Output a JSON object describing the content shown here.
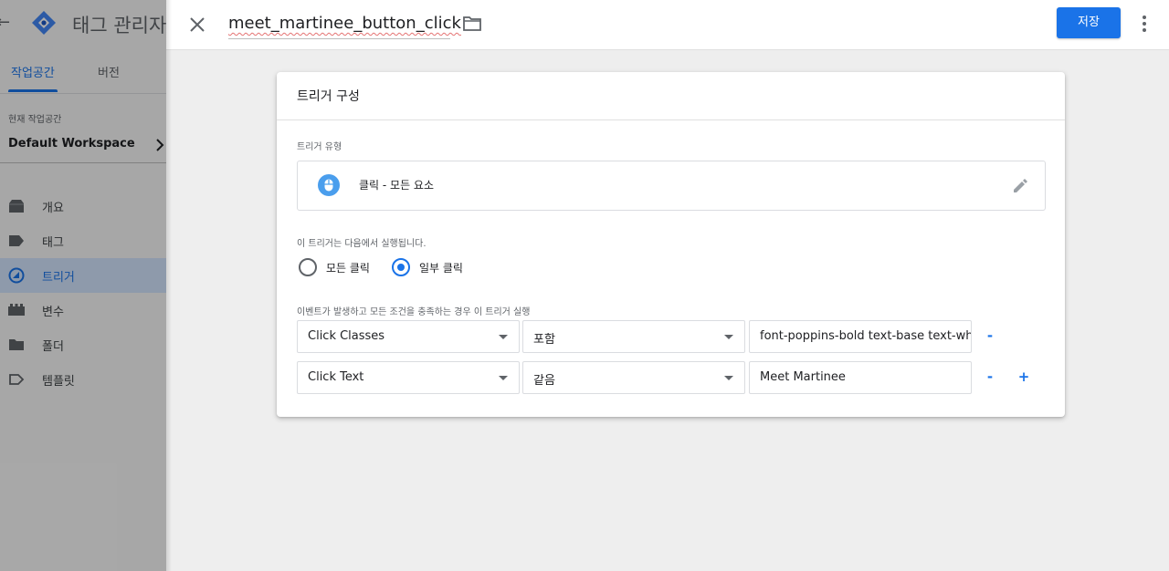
{
  "sidebar": {
    "back_glyph": "←",
    "app_title": "태그 관리자",
    "tabs": [
      {
        "label": "작업공간",
        "active": true
      },
      {
        "label": "버전",
        "active": false
      }
    ],
    "workspace_label": "현재 작업공간",
    "workspace_name": "Default Workspace",
    "nav": [
      {
        "label": "개요",
        "icon": "overview-icon"
      },
      {
        "label": "태그",
        "icon": "tag-icon"
      },
      {
        "label": "트리거",
        "icon": "trigger-icon",
        "active": true
      },
      {
        "label": "변수",
        "icon": "variable-icon"
      },
      {
        "label": "폴더",
        "icon": "folder-icon"
      },
      {
        "label": "템플릿",
        "icon": "template-icon"
      }
    ]
  },
  "topbar": {
    "trigger_name": "meet_martinee_button_click",
    "save_label": "저장"
  },
  "card": {
    "title": "트리거 구성",
    "type_label": "트리거 유형",
    "type_value": "클릭 - 모든 요소",
    "fires_on_label": "이 트리거는 다음에서 실행됩니다.",
    "radio_options": [
      {
        "label": "모든 클릭",
        "checked": false
      },
      {
        "label": "일부 클릭",
        "checked": true
      }
    ],
    "conditions_label": "이벤트가 발생하고 모든 조건을 충족하는 경우 이 트리거 실행",
    "conditions": [
      {
        "variable": "Click Classes",
        "operator": "포함",
        "value": "font-poppins-bold text-base text-white"
      },
      {
        "variable": "Click Text",
        "operator": "같음",
        "value": "Meet Martinee"
      }
    ],
    "remove_glyph": "-",
    "add_glyph": "+"
  },
  "colors": {
    "accent": "#1a73e8",
    "nav_active_bg": "#d2e3fc",
    "icon_blue": "#4a9eed"
  }
}
